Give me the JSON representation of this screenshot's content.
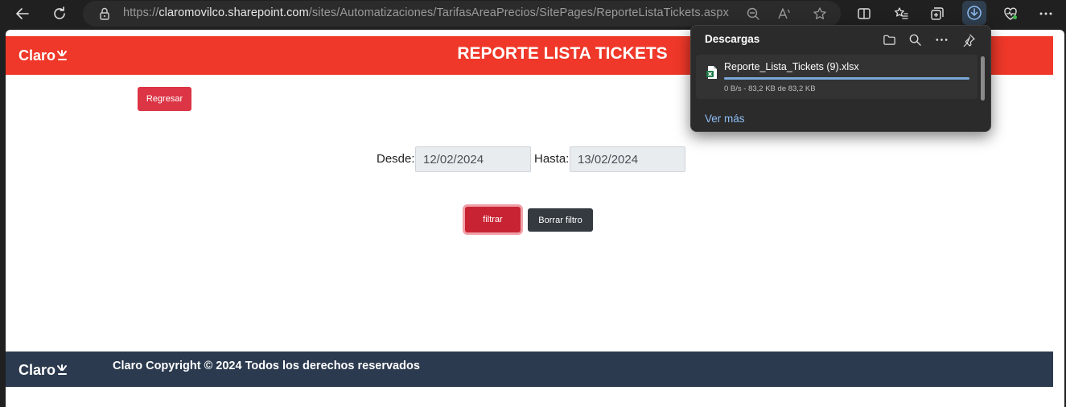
{
  "browser": {
    "url_prefix": "https://",
    "url_host": "claromovilco.sharepoint.com",
    "url_path": "/sites/Automatizaciones/TarifasAreaPrecios/SitePages/ReporteListaTickets.aspx",
    "font_size_indicator": "A"
  },
  "header": {
    "logo": "Claro",
    "title": "REPORTE LISTA TICKETS",
    "color": "#ef3829"
  },
  "actions": {
    "back_label": "Regresar",
    "filter_label": "filtrar",
    "clear_label": "Borrar filtro"
  },
  "filters": {
    "from_label": "Desde:",
    "from_value": "12/02/2024",
    "to_label": "Hasta:",
    "to_value": "13/02/2024"
  },
  "footer": {
    "logo": "Claro",
    "text": "Claro Copyright © 2024 Todos los derechos reservados",
    "color": "#2b3a4e"
  },
  "downloads": {
    "title": "Descargas",
    "file_name": "Reporte_Lista_Tickets (9).xlsx",
    "status": "0 B/s - 83,2 KB de 83,2 KB",
    "progress_percent": 100,
    "more_link": "Ver más"
  }
}
